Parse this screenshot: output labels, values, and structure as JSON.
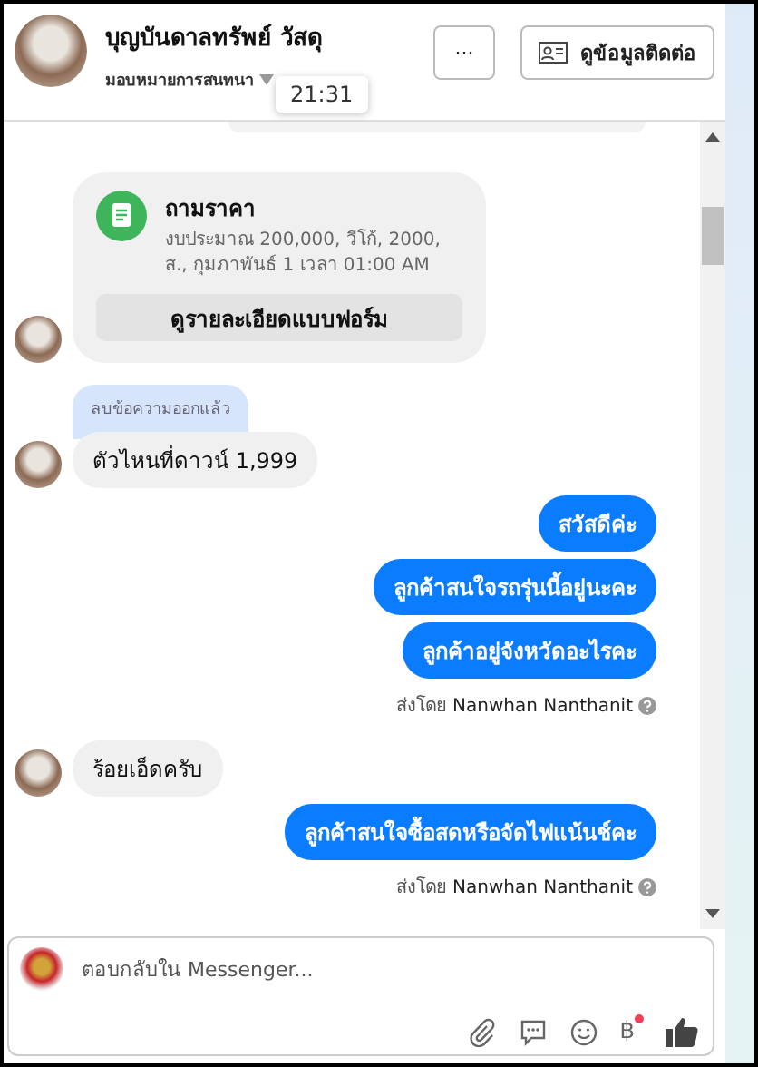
{
  "header": {
    "name": "บุญบันดาลทรัพย์ วัสดุ",
    "subtitle": "มอบหมายการสนทนา",
    "tooltip": "21:31",
    "more_button": "···",
    "contact_button": "ดูข้อมูลติดต่อ"
  },
  "messages": [
    {
      "kind": "form_card",
      "title": "ถามราคา",
      "detail": "งบประมาณ 200,000, วีโก้, 2000, ส., กุมภาพันธ์ 1 เวลา 01:00 AM",
      "button": "ดูรายละเอียดแบบฟอร์ม",
      "avatar": true
    },
    {
      "kind": "incoming",
      "note": "ลบข้อความออกแล้ว",
      "text": "ตัวไหนที่ดาวน์ 1,999",
      "avatar": true
    },
    {
      "kind": "outgoing",
      "text": "สวัสดีค่ะ"
    },
    {
      "kind": "outgoing",
      "text": "ลูกค้าสนใจรถรุ่นนี้อยู่นะคะ"
    },
    {
      "kind": "outgoing",
      "text": "ลูกค้าอยู่จังหวัดอะไรคะ"
    },
    {
      "kind": "sent_by",
      "prefix": "ส่งโดย",
      "name": "Nanwhan Nanthanit"
    },
    {
      "kind": "incoming",
      "text": "ร้อยเอ็ดครับ",
      "avatar": true
    },
    {
      "kind": "outgoing",
      "text": "ลูกค้าสนใจซื้อสดหรือจัดไฟแน้นช์คะ"
    },
    {
      "kind": "sent_by",
      "prefix": "ส่งโดย",
      "name": "Nanwhan Nanthanit"
    }
  ],
  "composer": {
    "placeholder": "ตอบกลับใน Messenger...",
    "currency_symbol": "฿",
    "currency_badge": true
  }
}
